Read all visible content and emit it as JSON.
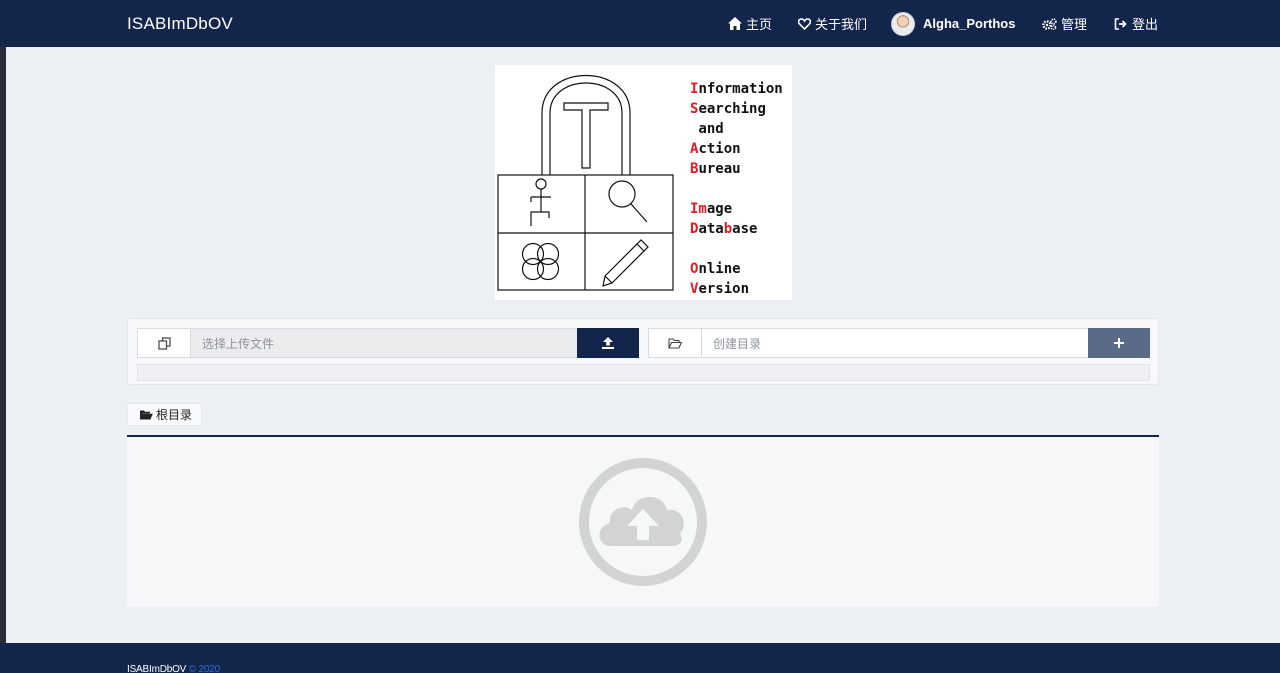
{
  "navbar": {
    "brand": "ISABImDbOV",
    "items": [
      {
        "label": "主页",
        "icon": "home-icon"
      },
      {
        "label": "关于我们",
        "icon": "heart-icon"
      },
      {
        "label": "Algha_Porthos",
        "icon": "avatar"
      },
      {
        "label": "管理",
        "icon": "gears-icon"
      },
      {
        "label": "登出",
        "icon": "logout-icon"
      }
    ]
  },
  "logo": {
    "lines": [
      {
        "first": "I",
        "rest": "nformation"
      },
      {
        "first": "S",
        "rest": "earching"
      },
      {
        "first": "",
        "rest": " and"
      },
      {
        "first": "A",
        "rest": "ction"
      },
      {
        "first": "B",
        "rest": "ureau"
      },
      {
        "first": "",
        "rest": ""
      },
      {
        "first": "Im",
        "rest": "age"
      },
      {
        "first": "D",
        "rest": "ata",
        "mid": "b",
        "tail": "ase"
      },
      {
        "first": "",
        "rest": ""
      },
      {
        "first": "O",
        "rest": "nline"
      },
      {
        "first": "V",
        "rest": "ersion"
      }
    ]
  },
  "upload": {
    "file_placeholder": "选择上传文件",
    "upload_icon": "upload-icon",
    "folder_placeholder": "创建目录",
    "create_icon": "plus-icon"
  },
  "breadcrumb": {
    "root": "根目录"
  },
  "footer": {
    "name": "ISABImDbOV",
    "year": "© 2020"
  },
  "colors": {
    "navbar": "#13254a",
    "upload_button": "#13254a",
    "create_button": "#5a6b88",
    "logo_accent": "#e01b24",
    "footer_year": "#2c6fd6"
  }
}
